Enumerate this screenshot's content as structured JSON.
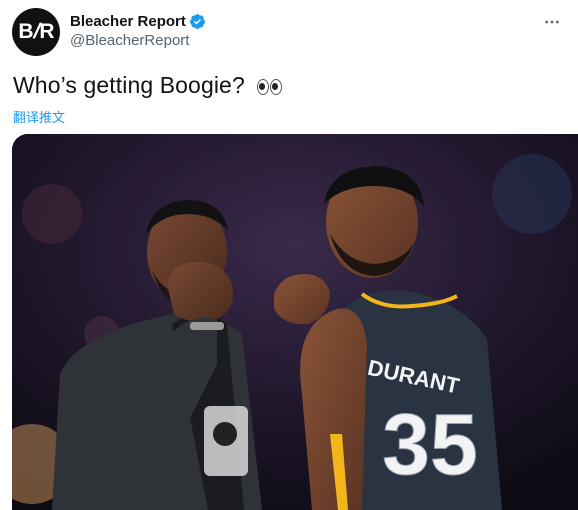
{
  "account": {
    "display_name": "Bleacher Report",
    "handle": "@BleacherReport",
    "avatar_text": "B/R",
    "verified": true
  },
  "tweet": {
    "text": "Who’s getting Boogie?",
    "emoji": "eyes",
    "translate_label": "翻译推文"
  },
  "media": {
    "jersey_name": "DURANT",
    "jersey_number": "35"
  },
  "colors": {
    "link_blue": "#1d9bf0",
    "verified_blue": "#1d9bf0",
    "secondary_text": "#536471"
  }
}
